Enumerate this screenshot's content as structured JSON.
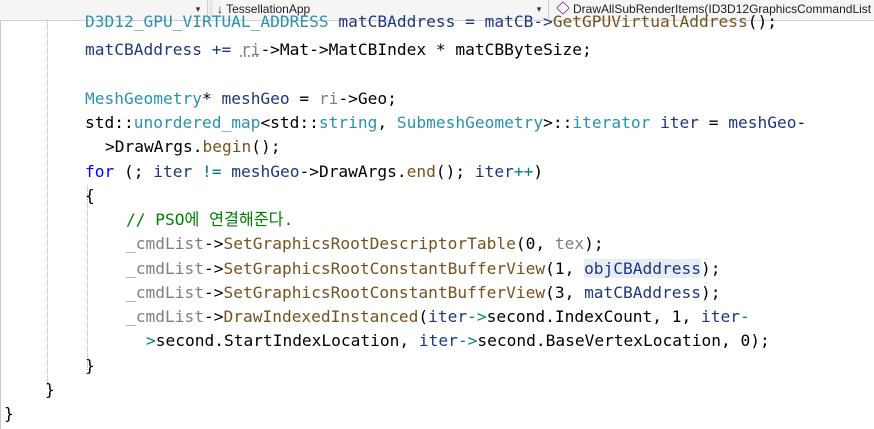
{
  "navbar": {
    "left_scope": "",
    "project": "TessellationApp",
    "function": "DrawAllSubRenderItems(ID3D12GraphicsCommandList",
    "dropdown_glyph": "▾",
    "arrow_glyph": "↓"
  },
  "code": {
    "line0": [
      "D3D12_GPU_VIRTUAL_ADDRESS",
      " matCBAddress = matCB->",
      "GetGPUVirtualAddress",
      "();"
    ],
    "line1": [
      "matCBAddress += ",
      "ri",
      "->Mat->MatCBIndex * matCBByteSize;"
    ],
    "line3": [
      "MeshGeometry",
      "* ",
      "meshGeo",
      " = ",
      "ri",
      "->Geo;"
    ],
    "line4": [
      "std::",
      "unordered_map",
      "<std::",
      "string",
      ", ",
      "SubmeshGeometry",
      ">::",
      "iterator",
      " ",
      "iter",
      " = ",
      "meshGeo",
      "-"
    ],
    "line5": [
      ">DrawArgs.",
      "begin",
      "();"
    ],
    "line6": [
      "for",
      " (; ",
      "iter",
      " ",
      "!=",
      " ",
      "meshGeo",
      "->DrawArgs.",
      "end",
      "(); ",
      "iter",
      "++",
      ")"
    ],
    "line7": [
      "{"
    ],
    "line8": [
      "// PSO에 연결해준다."
    ],
    "line9": [
      "_cmdList",
      "->",
      "SetGraphicsRootDescriptorTable",
      "(0, ",
      "tex",
      ");"
    ],
    "line10": [
      "_cmdList",
      "->",
      "SetGraphicsRootConstantBufferView",
      "(1, ",
      "objCBAddress",
      ");"
    ],
    "line11": [
      "_cmdList",
      "->",
      "SetGraphicsRootConstantBufferView",
      "(3, ",
      "matCBAddress",
      ");"
    ],
    "line12": [
      "_cmdList",
      "->",
      "DrawIndexedInstanced",
      "(",
      "iter",
      "->",
      "second.IndexCount, 1, ",
      "iter",
      "-"
    ],
    "line13": [
      ">",
      "second.StartIndexLocation, ",
      "iter",
      "->",
      "second.BaseVertexLocation, 0);"
    ],
    "line14": [
      "}"
    ],
    "line15": [
      "}"
    ],
    "line16": [
      "}"
    ]
  }
}
